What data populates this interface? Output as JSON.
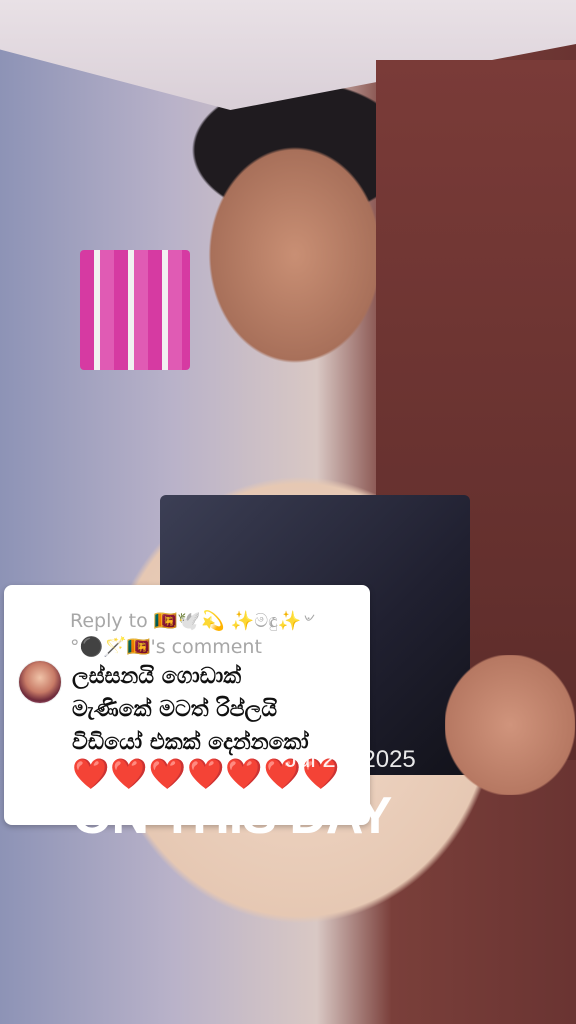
{
  "comment": {
    "reply_prefix": "Reply to 🇱🇰🕊️💫 ✨️මඳු✨️৺",
    "reply_suffix": "°⚫️🪄🇱🇰's comment",
    "text": "ලස්සනයි ගොඩාක්\nමැණිකේ මටත් රිප්ලයි\nවිඩියෝ එකක් දෙන්නකෝ",
    "hearts": "❤️❤️❤️❤️❤️❤️❤️"
  },
  "overlay": {
    "date": "Jul 26, 2025",
    "title": "ON THIS DAY"
  }
}
